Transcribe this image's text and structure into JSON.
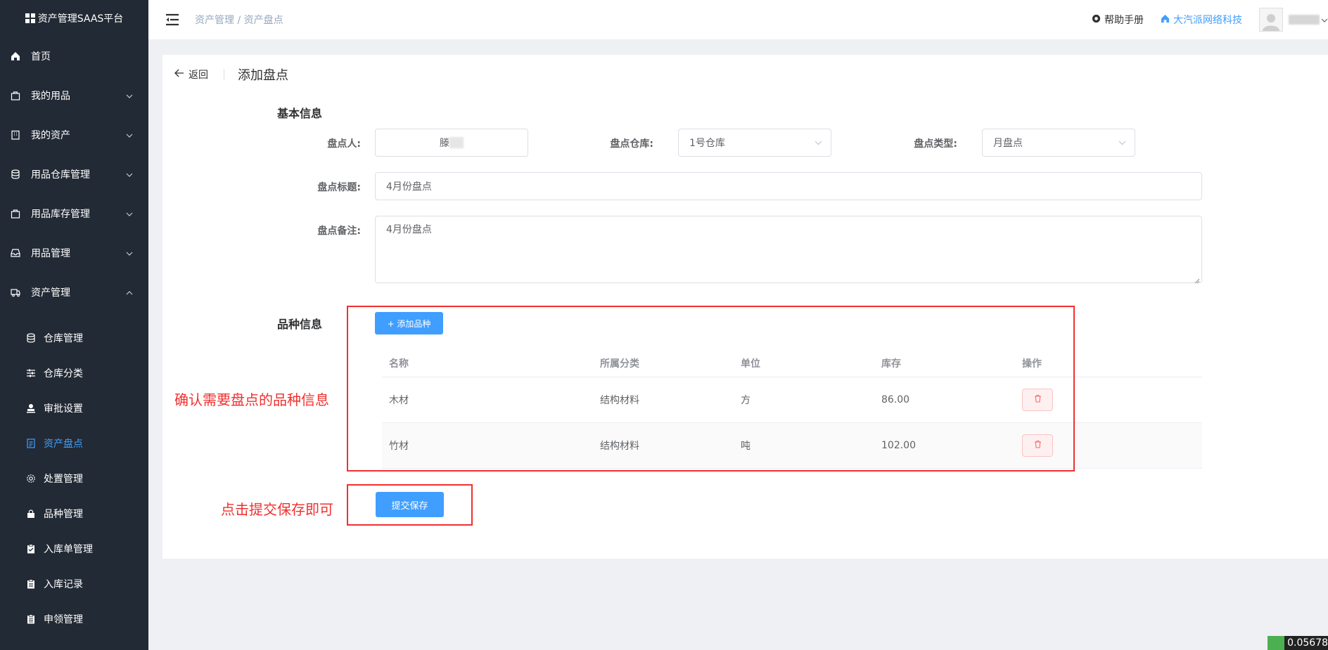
{
  "app": {
    "title": "资产管理SAAS平台"
  },
  "sidebar": {
    "items": [
      {
        "label": "首页",
        "icon": "home-icon"
      },
      {
        "label": "我的用品",
        "icon": "bag-icon"
      },
      {
        "label": "我的资产",
        "icon": "building-icon"
      },
      {
        "label": "用品仓库管理",
        "icon": "database-icon"
      },
      {
        "label": "用品库存管理",
        "icon": "bag-icon"
      },
      {
        "label": "用品管理",
        "icon": "inbox-icon"
      },
      {
        "label": "资产管理",
        "icon": "truck-icon"
      }
    ],
    "subitems": [
      {
        "label": "仓库管理"
      },
      {
        "label": "仓库分类"
      },
      {
        "label": "审批设置"
      },
      {
        "label": "资产盘点"
      },
      {
        "label": "处置管理"
      },
      {
        "label": "品种管理"
      },
      {
        "label": "入库单管理"
      },
      {
        "label": "入库记录"
      },
      {
        "label": "申领管理"
      }
    ]
  },
  "header": {
    "breadcrumb": "资产管理 / 资产盘点",
    "help": "帮助手册",
    "company": "大汽派网络科技"
  },
  "page": {
    "back": "返回",
    "title": "添加盘点"
  },
  "basic": {
    "section": "基本信息",
    "checker_label": "盘点人:",
    "checker_value": "滕",
    "warehouse_label": "盘点仓库:",
    "warehouse_value": "1号仓库",
    "type_label": "盘点类型:",
    "type_value": "月盘点",
    "title_label": "盘点标题:",
    "title_value": "4月份盘点",
    "remark_label": "盘点备注:",
    "remark_value": "4月份盘点"
  },
  "variety": {
    "section": "品种信息",
    "add_button": "+ 添加品种",
    "columns": [
      "名称",
      "所属分类",
      "单位",
      "库存",
      "操作"
    ],
    "rows": [
      {
        "name": "木材",
        "category": "结构材料",
        "unit": "方",
        "stock": "86.00"
      },
      {
        "name": "竹材",
        "category": "结构材料",
        "unit": "吨",
        "stock": "102.00"
      }
    ]
  },
  "submit": "提交保存",
  "annotations": {
    "confirm": "确认需要盘点的品种信息",
    "click": "点击提交保存即可"
  },
  "corner": "0.05678",
  "colors": {
    "primary": "#409eff",
    "sidebar": "#222a35",
    "annotation": "#f0302e"
  }
}
